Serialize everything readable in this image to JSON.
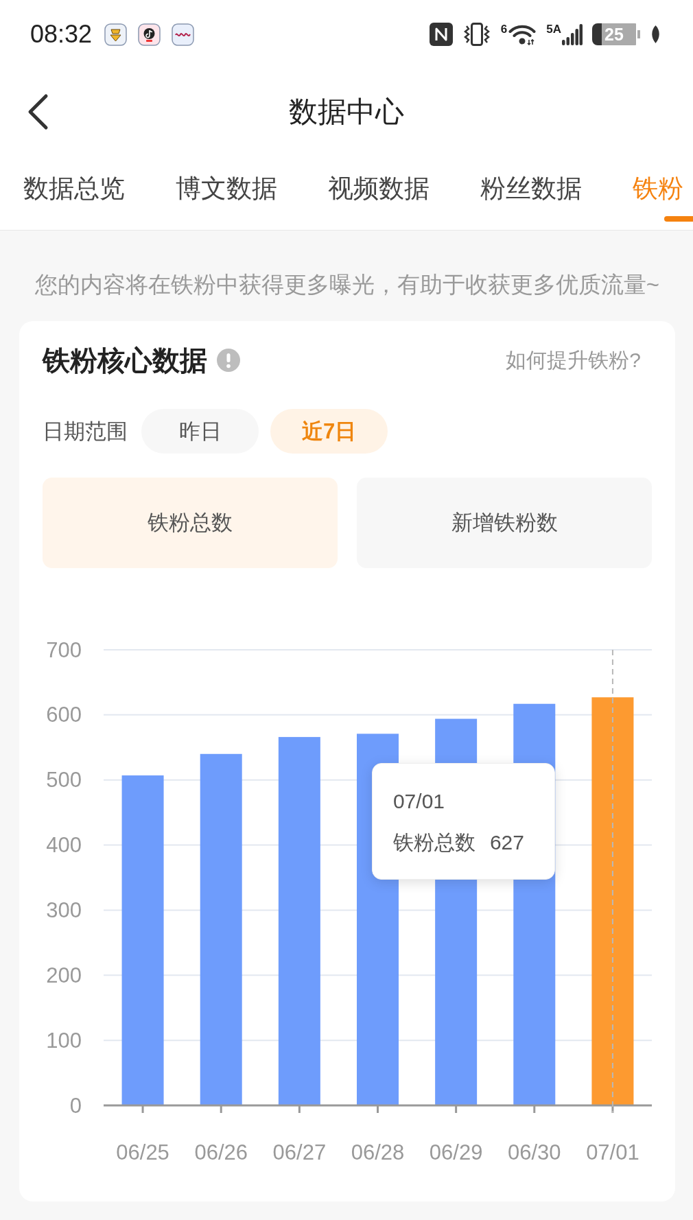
{
  "status_bar": {
    "time": "08:32",
    "wifi_badge": "6",
    "signal_badge": "5A",
    "battery": "25"
  },
  "header": {
    "title": "数据中心"
  },
  "tabs": [
    {
      "label": "数据总览",
      "selected": false
    },
    {
      "label": "博文数据",
      "selected": false
    },
    {
      "label": "视频数据",
      "selected": false
    },
    {
      "label": "粉丝数据",
      "selected": false
    },
    {
      "label": "铁粉",
      "selected": true
    }
  ],
  "notice": "您的内容将在铁粉中获得更多曝光，有助于收获更多优质流量~",
  "core_data": {
    "title": "铁粉核心数据",
    "help_link": "如何提升铁粉?",
    "date_range": {
      "label": "日期范围",
      "options": [
        {
          "label": "昨日",
          "selected": false
        },
        {
          "label": "近7日",
          "selected": true
        }
      ]
    },
    "metrics": [
      {
        "label": "铁粉总数",
        "selected": true
      },
      {
        "label": "新增铁粉数",
        "selected": false
      }
    ],
    "chart_data": {
      "type": "bar",
      "categories": [
        "06/25",
        "06/26",
        "06/27",
        "06/28",
        "06/29",
        "06/30",
        "07/01"
      ],
      "series": [
        {
          "color": "#6e9cfc",
          "values": [
            507,
            540,
            566,
            571,
            594,
            617,
            null
          ]
        },
        {
          "color": "#fd9a30",
          "values": [
            null,
            null,
            null,
            null,
            null,
            null,
            627
          ]
        }
      ],
      "stacked": true,
      "grid": true,
      "ylim": [
        0,
        700
      ],
      "yticks": [
        0,
        100,
        200,
        300,
        400,
        500,
        600,
        700
      ],
      "ref_lines": [
        {
          "axis": "x",
          "value": "07/01",
          "color": "#b8b8b8"
        }
      ]
    },
    "tooltip": {
      "date": "07/01",
      "label": "铁粉总数",
      "value": "627"
    }
  }
}
